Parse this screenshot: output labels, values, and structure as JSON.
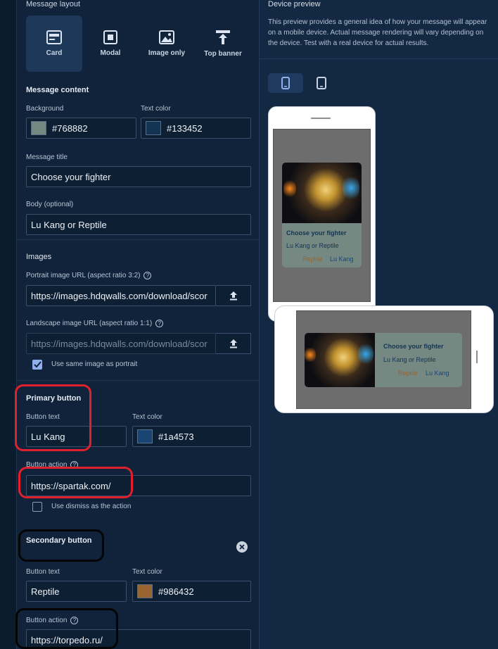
{
  "layout_section": {
    "title": "Message layout",
    "options": [
      {
        "label": "Card",
        "icon": "card-layout-icon",
        "active": true
      },
      {
        "label": "Modal",
        "icon": "modal-layout-icon",
        "active": false
      },
      {
        "label": "Image only",
        "icon": "image-icon",
        "active": false
      },
      {
        "label": "Top banner",
        "icon": "top-banner-icon",
        "active": false
      }
    ]
  },
  "content": {
    "title": "Message content",
    "background_label": "Background",
    "background_value": "#768882",
    "text_color_label": "Text color",
    "text_color_value": "#133452",
    "message_title_label": "Message title",
    "message_title_value": "Choose your fighter",
    "body_label": "Body (optional)",
    "body_value": "Lu Kang or Reptile"
  },
  "images": {
    "title": "Images",
    "portrait_label": "Portrait image URL (aspect ratio 3:2)",
    "portrait_value": "https://images.hdqwalls.com/download/scor",
    "landscape_label": "Landscape image URL (aspect ratio 1:1)",
    "landscape_value": "https://images.hdqwalls.com/download/scor",
    "same_image_label": "Use same image as portrait",
    "same_image_checked": true
  },
  "primary": {
    "title": "Primary button",
    "text_label": "Button text",
    "text_value": "Lu Kang",
    "color_label": "Text color",
    "color_value": "#1a4573",
    "action_label": "Button action",
    "action_value": "https://spartak.com/",
    "dismiss_label": "Use dismiss as the action",
    "dismiss_checked": false
  },
  "secondary": {
    "title": "Secondary button",
    "text_label": "Button text",
    "text_value": "Reptile",
    "color_label": "Text color",
    "color_value": "#986432",
    "action_label": "Button action",
    "action_value": "https://torpedo.ru/"
  },
  "preview": {
    "title": "Device preview",
    "description": "This preview provides a general idea of how your message will appear on a mobile device. Actual message rendering will vary depending on the device. Test with a real device for actual results.",
    "card_title": "Choose your fighter",
    "card_body": "Lu Kang or Reptile",
    "card_secondary": "Reptile",
    "card_primary": "Lu Kang"
  },
  "help_glyph": "?",
  "colors": {
    "highlight_red": "#e0202c",
    "highlight_black": "#050505",
    "accent": "#8fb0ec"
  }
}
